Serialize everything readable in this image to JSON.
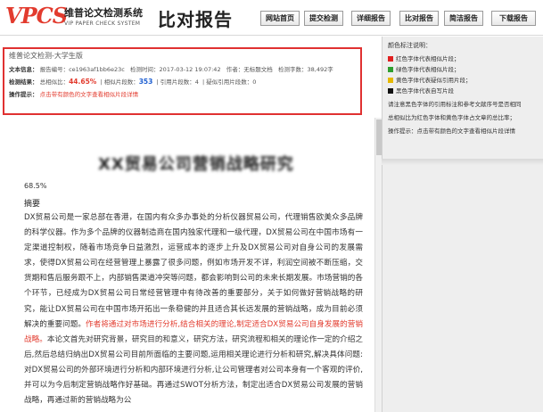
{
  "header": {
    "logo_text": "VPCS",
    "logo_cn": "维普论文检测系统",
    "logo_en": "VIP PAPER CHECK SYSTEM",
    "title": "比对报告",
    "nav": [
      {
        "label": "网站首页"
      },
      {
        "label": "提交检测"
      },
      {
        "label": "详细报告"
      },
      {
        "label": "比对报告"
      },
      {
        "label": "简洁报告"
      },
      {
        "label": "下载报告"
      }
    ]
  },
  "info": {
    "title": "维普论文检测-大学生版",
    "row1": {
      "label": "文本信息：",
      "report_no": "报告编号：ce1963af1bb6e23c",
      "time": "检测时间：2017-03-12 19:07:42",
      "author": "作者：无标题文档",
      "chars": "检测字数：38,492字"
    },
    "row2": {
      "label": "检测结果：",
      "total_label": "总相似比：",
      "total_value": "44.65%",
      "segments_label": "相似片段数：",
      "segments_value": "353",
      "cited_label": "引用片段数：4",
      "suspect_label": "疑似引用片段数：0"
    },
    "row3": {
      "label": "操作提示：",
      "text": "点击带有颜色的文字查看相似片段详情"
    }
  },
  "document": {
    "heading": "XX贸易公司营销战略研究",
    "percent": "68.5%",
    "abstract_label": "摘要",
    "para_a": "DX贸易公司是一家总部在香港，在国内有众多办事处的分析仪器贸易公司，代理销售欧美众多品牌的科学仪器。作为多个品牌的仪器制造商在国内独家代理和一级代理，DX贸易公司在中国市场有一定渠道控制权，随着市场竞争日益激烈，运营成本的逐步上升及DX贸易公司对自身公司的发展需求，使得DX贸易公司在经营管理上暴露了很多问题，例如市场开发不详，利润空间被不断压缩，交货期和售后服务跟不上，内部销售渠道冲突等问题，都会影响到公司的未来长期发展。市场营销的各个环节，已经成为DX贸易公司日常经营管理中有待改善的重要部分，关于如何做好营销战略的研究，能让DX贸易公司在中国市场开拓出一条稳健的并且适合其长远发展的营销战略，成为目前必须解决的重要问题。",
    "para_hl": "作者将通过对市场进行分析,结合相关的理论,制定适合DX贸易公司自身发展的营销战略。",
    "para_b": "本论文首先对研究背景，研究目的和意义，研究方法，研究流程和相关的理论作一定的介绍之后,然后总结归纳出DX贸易公司目前所面临的主要问题,运用相关理论进行分析和研究,解决具体问题:对DX贸易公司的外部环境进行分析和内部环境进行分析,让公司管理者对公司本身有一个客观的评价,并可以为今后制定营销战略作好基础。再通过SWOT分析方法，制定出适合DX贸易公司发展的营销战略，再通过新的营销战略为公"
  },
  "legend": {
    "title": "颜色标注说明：",
    "items": [
      {
        "label": "红色字体代表相似片段；",
        "color": "#e02020"
      },
      {
        "label": "绿色字体代表相似片段；",
        "color": "#2f9e2f"
      },
      {
        "label": "黄色字体代表疑似引用片段；",
        "color": "#e5b800"
      },
      {
        "label": "黑色字体代表自写片段",
        "color": "#111111"
      }
    ],
    "note1": "请注意黑色字体的引用标注和参考文献序号是否相同",
    "note2": "总相似比为红色字体和黄色字体占文章的总比率；",
    "note3": "操作提示：点击带有颜色的文字查看相似片段详情"
  }
}
